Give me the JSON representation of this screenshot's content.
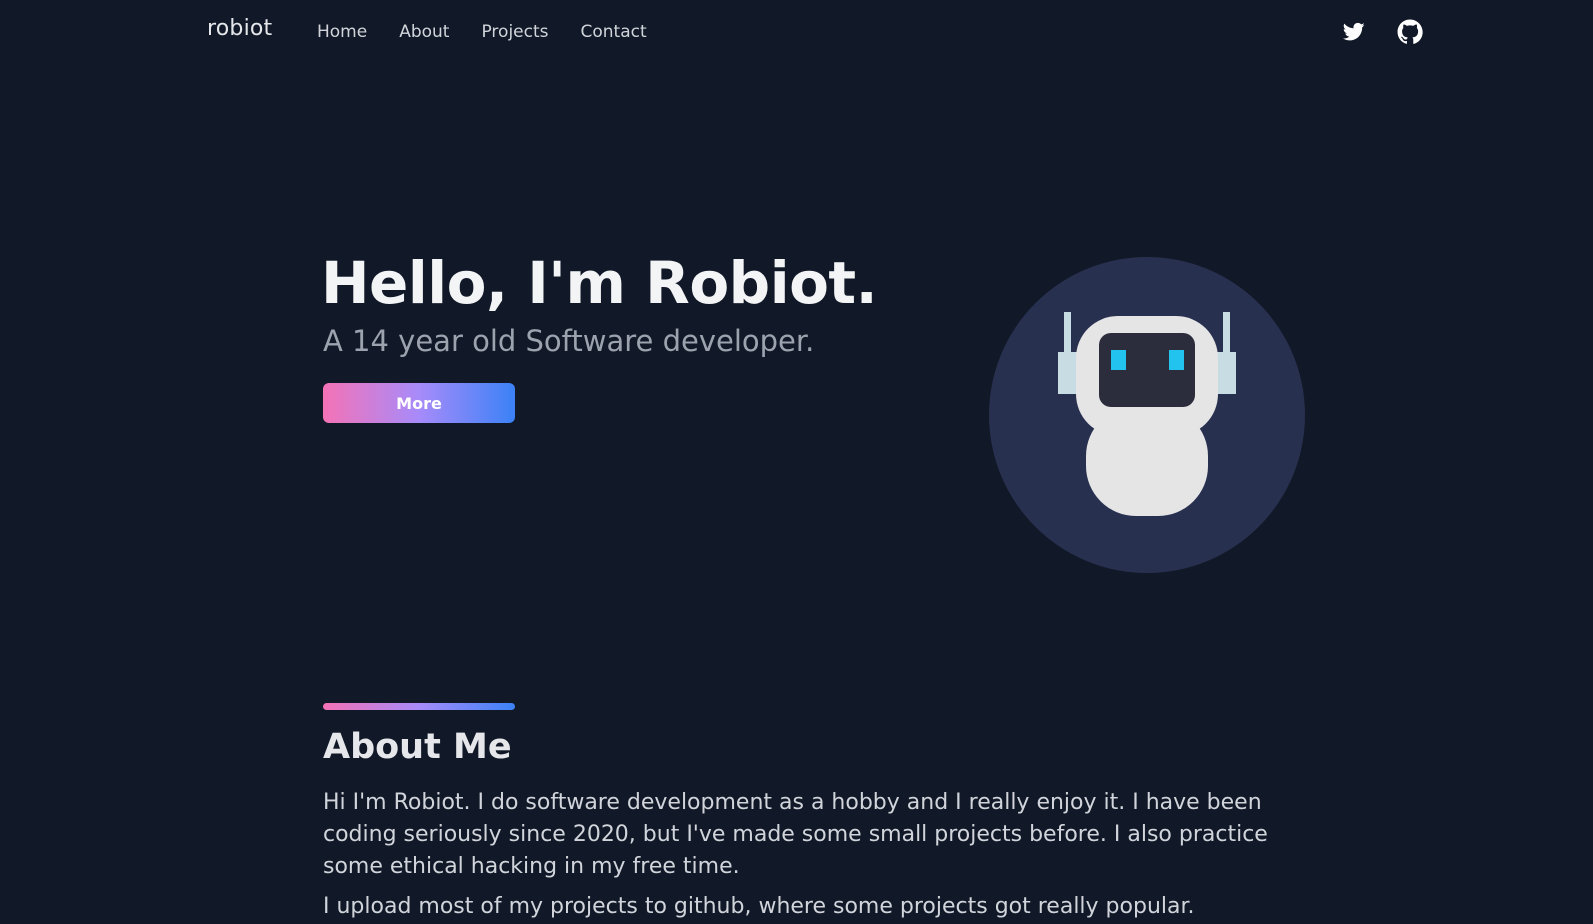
{
  "nav": {
    "brand": "robiot",
    "links": [
      {
        "label": "Home"
      },
      {
        "label": "About"
      },
      {
        "label": "Projects"
      },
      {
        "label": "Contact"
      }
    ],
    "social": [
      {
        "icon": "twitter-icon"
      },
      {
        "icon": "github-icon"
      }
    ]
  },
  "hero": {
    "title": "Hello, I'm Robiot.",
    "subtitle": "A 14 year old Software developer.",
    "button_label": "More",
    "avatar_icon": "robot-avatar-icon"
  },
  "about": {
    "title": "About Me",
    "paragraph1": "Hi I'm Robiot. I do software development as a hobby and I really enjoy it. I have been coding seriously since 2020, but I've made some small projects before. I also practice some ethical hacking in my free time.",
    "paragraph2": "I upload most of my projects to github, where some projects got really popular."
  },
  "colors": {
    "background": "#111827",
    "avatar_circle": "#283050",
    "gradient_start": "#f472b6",
    "gradient_end": "#3b82f6",
    "robot_eyes": "#22c3ee"
  }
}
